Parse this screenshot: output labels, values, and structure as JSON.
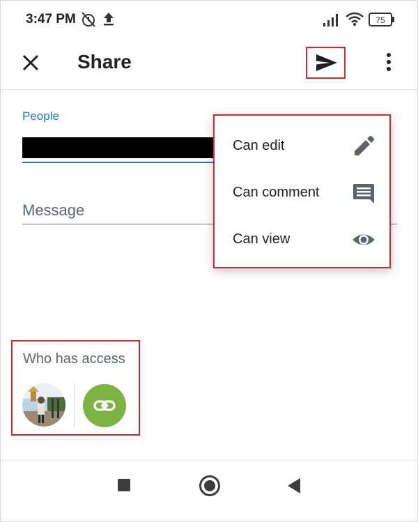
{
  "status_bar": {
    "time": "3:47 PM",
    "battery": "75",
    "icons": [
      "alarm-off-icon",
      "upload-icon",
      "signal-icon",
      "wifi-icon",
      "battery-icon"
    ]
  },
  "app_bar": {
    "title": "Share",
    "icons": [
      "close-icon",
      "send-icon",
      "more-vert-icon"
    ]
  },
  "people": {
    "label": "People",
    "value_redacted": true
  },
  "message": {
    "placeholder": "Message",
    "value": ""
  },
  "role_menu": {
    "items": [
      {
        "label": "Can edit",
        "icon": "pencil-icon"
      },
      {
        "label": "Can comment",
        "icon": "comment-icon"
      },
      {
        "label": "Can view",
        "icon": "eye-icon"
      }
    ]
  },
  "access": {
    "title": "Who has access",
    "icons": [
      "avatar",
      "link-icon"
    ]
  },
  "nav_bar": {
    "icons": [
      "recents-square-icon",
      "home-circle-icon",
      "back-triangle-icon"
    ]
  },
  "colors": {
    "accent_blue": "#1a73e8",
    "highlight_red": "#d6262e",
    "link_green": "#7cb342",
    "icon_grey": "#5f6368"
  }
}
